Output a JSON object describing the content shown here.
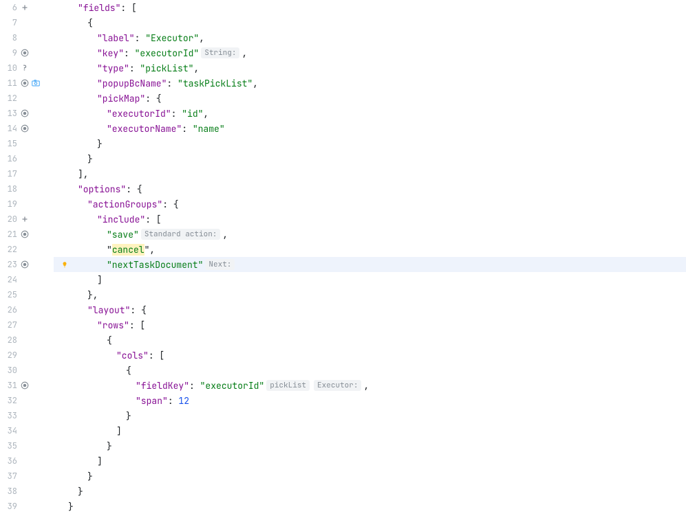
{
  "lines": [
    {
      "num": 6,
      "icons": [
        "plus"
      ],
      "indent": 1,
      "tokens": [
        {
          "t": "key",
          "v": "\"fields\""
        },
        {
          "t": "punct",
          "v": ": ["
        }
      ]
    },
    {
      "num": 7,
      "icons": [],
      "indent": 2,
      "tokens": [
        {
          "t": "punct",
          "v": "{"
        }
      ]
    },
    {
      "num": 8,
      "icons": [],
      "indent": 3,
      "tokens": [
        {
          "t": "key",
          "v": "\"label\""
        },
        {
          "t": "punct",
          "v": ": "
        },
        {
          "t": "str",
          "v": "\"Executor\""
        },
        {
          "t": "punct",
          "v": ","
        }
      ]
    },
    {
      "num": 9,
      "icons": [
        "eye"
      ],
      "indent": 3,
      "tokens": [
        {
          "t": "key",
          "v": "\"key\""
        },
        {
          "t": "punct",
          "v": ": "
        },
        {
          "t": "str",
          "v": "\"executorId\""
        },
        {
          "t": "inlay",
          "v": "String:"
        },
        {
          "t": "punct",
          "v": ","
        }
      ]
    },
    {
      "num": 10,
      "icons": [
        "question"
      ],
      "indent": 3,
      "tokens": [
        {
          "t": "key",
          "v": "\"type\""
        },
        {
          "t": "punct",
          "v": ": "
        },
        {
          "t": "str",
          "v": "\"pickList\""
        },
        {
          "t": "punct",
          "v": ","
        }
      ]
    },
    {
      "num": 11,
      "icons": [
        "eye",
        "camera"
      ],
      "indent": 3,
      "tokens": [
        {
          "t": "key",
          "v": "\"popupBcName\""
        },
        {
          "t": "punct",
          "v": ": "
        },
        {
          "t": "str",
          "v": "\"taskPickList\""
        },
        {
          "t": "punct",
          "v": ","
        }
      ]
    },
    {
      "num": 12,
      "icons": [],
      "indent": 3,
      "tokens": [
        {
          "t": "key",
          "v": "\"pickMap\""
        },
        {
          "t": "punct",
          "v": ": {"
        }
      ]
    },
    {
      "num": 13,
      "icons": [
        "eye"
      ],
      "indent": 4,
      "tokens": [
        {
          "t": "key",
          "v": "\"executorId\""
        },
        {
          "t": "punct",
          "v": ": "
        },
        {
          "t": "str",
          "v": "\"id\""
        },
        {
          "t": "punct",
          "v": ","
        }
      ]
    },
    {
      "num": 14,
      "icons": [
        "eye"
      ],
      "indent": 4,
      "tokens": [
        {
          "t": "key",
          "v": "\"executorName\""
        },
        {
          "t": "punct",
          "v": ": "
        },
        {
          "t": "str",
          "v": "\"name\""
        }
      ]
    },
    {
      "num": 15,
      "icons": [],
      "indent": 3,
      "tokens": [
        {
          "t": "punct",
          "v": "}"
        }
      ]
    },
    {
      "num": 16,
      "icons": [],
      "indent": 2,
      "tokens": [
        {
          "t": "punct",
          "v": "}"
        }
      ]
    },
    {
      "num": 17,
      "icons": [],
      "indent": 1,
      "tokens": [
        {
          "t": "punct",
          "v": "],"
        }
      ]
    },
    {
      "num": 18,
      "icons": [],
      "indent": 1,
      "tokens": [
        {
          "t": "key",
          "v": "\"options\""
        },
        {
          "t": "punct",
          "v": ": {"
        }
      ]
    },
    {
      "num": 19,
      "icons": [],
      "indent": 2,
      "tokens": [
        {
          "t": "key",
          "v": "\"actionGroups\""
        },
        {
          "t": "punct",
          "v": ": {"
        }
      ]
    },
    {
      "num": 20,
      "icons": [
        "plus"
      ],
      "indent": 3,
      "tokens": [
        {
          "t": "key",
          "v": "\"include\""
        },
        {
          "t": "punct",
          "v": ": ["
        }
      ]
    },
    {
      "num": 21,
      "icons": [
        "eye"
      ],
      "indent": 4,
      "tokens": [
        {
          "t": "str",
          "v": "\"save\""
        },
        {
          "t": "inlay",
          "v": "Standard action:"
        },
        {
          "t": "punct",
          "v": ","
        }
      ]
    },
    {
      "num": 22,
      "icons": [],
      "indent": 4,
      "tokens": [
        {
          "t": "punct",
          "v": "\""
        },
        {
          "t": "highlight",
          "v": "cancel"
        },
        {
          "t": "punct",
          "v": "\","
        }
      ]
    },
    {
      "num": 23,
      "icons": [
        "eye"
      ],
      "indent": 4,
      "highlighted": true,
      "bulb": true,
      "tokens": [
        {
          "t": "str",
          "v": "\"nextTaskDocument\""
        },
        {
          "t": "inlay",
          "v": "Next:"
        }
      ]
    },
    {
      "num": 24,
      "icons": [],
      "indent": 3,
      "tokens": [
        {
          "t": "punct",
          "v": "]"
        }
      ]
    },
    {
      "num": 25,
      "icons": [],
      "indent": 2,
      "tokens": [
        {
          "t": "punct",
          "v": "},"
        }
      ]
    },
    {
      "num": 26,
      "icons": [],
      "indent": 2,
      "tokens": [
        {
          "t": "key",
          "v": "\"layout\""
        },
        {
          "t": "punct",
          "v": ": {"
        }
      ]
    },
    {
      "num": 27,
      "icons": [],
      "indent": 3,
      "tokens": [
        {
          "t": "key",
          "v": "\"rows\""
        },
        {
          "t": "punct",
          "v": ": ["
        }
      ]
    },
    {
      "num": 28,
      "icons": [],
      "indent": 4,
      "tokens": [
        {
          "t": "punct",
          "v": "{"
        }
      ]
    },
    {
      "num": 29,
      "icons": [],
      "indent": 5,
      "tokens": [
        {
          "t": "key",
          "v": "\"cols\""
        },
        {
          "t": "punct",
          "v": ": ["
        }
      ]
    },
    {
      "num": 30,
      "icons": [],
      "indent": 6,
      "tokens": [
        {
          "t": "punct",
          "v": "{"
        }
      ]
    },
    {
      "num": 31,
      "icons": [
        "eye"
      ],
      "indent": 7,
      "tokens": [
        {
          "t": "key",
          "v": "\"fieldKey\""
        },
        {
          "t": "punct",
          "v": ": "
        },
        {
          "t": "str",
          "v": "\"executorId\""
        },
        {
          "t": "inlay",
          "v": "pickList"
        },
        {
          "t": "inlay",
          "v": "Executor:"
        },
        {
          "t": "punct",
          "v": ","
        }
      ]
    },
    {
      "num": 32,
      "icons": [],
      "indent": 7,
      "tokens": [
        {
          "t": "key",
          "v": "\"span\""
        },
        {
          "t": "punct",
          "v": ": "
        },
        {
          "t": "num",
          "v": "12"
        }
      ]
    },
    {
      "num": 33,
      "icons": [],
      "indent": 6,
      "tokens": [
        {
          "t": "punct",
          "v": "}"
        }
      ]
    },
    {
      "num": 34,
      "icons": [],
      "indent": 5,
      "tokens": [
        {
          "t": "punct",
          "v": "]"
        }
      ]
    },
    {
      "num": 35,
      "icons": [],
      "indent": 4,
      "tokens": [
        {
          "t": "punct",
          "v": "}"
        }
      ]
    },
    {
      "num": 36,
      "icons": [],
      "indent": 3,
      "tokens": [
        {
          "t": "punct",
          "v": "]"
        }
      ]
    },
    {
      "num": 37,
      "icons": [],
      "indent": 2,
      "tokens": [
        {
          "t": "punct",
          "v": "}"
        }
      ]
    },
    {
      "num": 38,
      "icons": [],
      "indent": 1,
      "tokens": [
        {
          "t": "punct",
          "v": "}"
        }
      ]
    },
    {
      "num": 39,
      "icons": [],
      "indent": 0,
      "tokens": [
        {
          "t": "punct",
          "v": "}"
        }
      ]
    }
  ]
}
